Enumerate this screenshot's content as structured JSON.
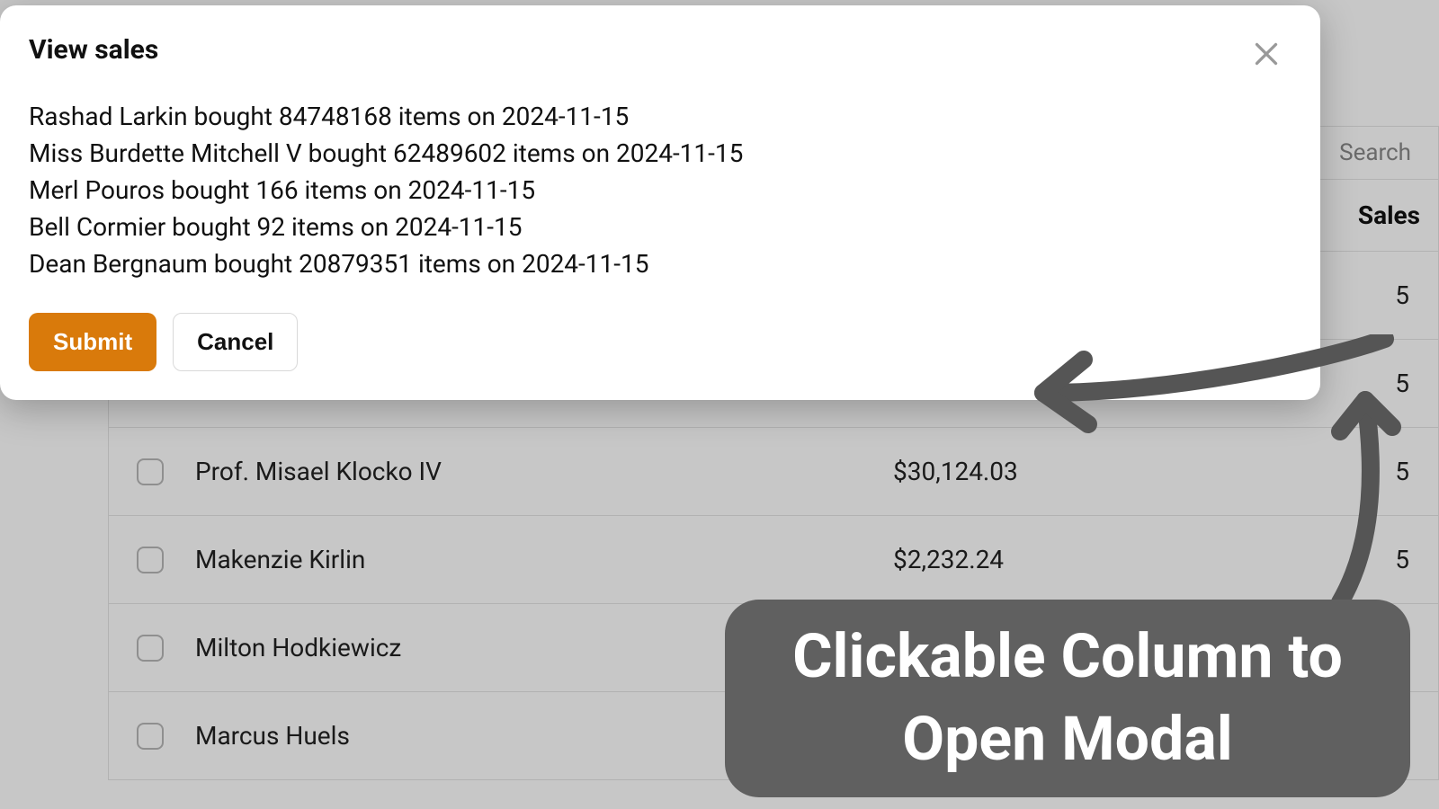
{
  "modal": {
    "title": "View sales",
    "lines": [
      "Rashad Larkin bought 84748168 items on 2024-11-15",
      "Miss Burdette Mitchell V bought 62489602 items on 2024-11-15",
      "Merl Pouros bought 166 items on 2024-11-15",
      "Bell Cormier bought 92 items on 2024-11-15",
      "Dean Bergnaum bought 20879351 items on 2024-11-15"
    ],
    "submit_label": "Submit",
    "cancel_label": "Cancel"
  },
  "table": {
    "search_placeholder": "Search",
    "header": {
      "sales": "Sales"
    },
    "rows": [
      {
        "name": "",
        "price": "",
        "sales": "5"
      },
      {
        "name": "",
        "price": "",
        "sales": "5"
      },
      {
        "name": "Prof. Misael Klocko IV",
        "price": "$30,124.03",
        "sales": "5"
      },
      {
        "name": "Makenzie Kirlin",
        "price": "$2,232.24",
        "sales": "5"
      },
      {
        "name": "Milton Hodkiewicz",
        "price": "",
        "sales": ""
      },
      {
        "name": "Marcus Huels",
        "price": "",
        "sales": ""
      }
    ]
  },
  "annotation": {
    "callout": "Clickable Column to Open Modal"
  },
  "colors": {
    "primary": "#d97a0b",
    "callout_bg": "#606060",
    "arrow": "#555555"
  }
}
